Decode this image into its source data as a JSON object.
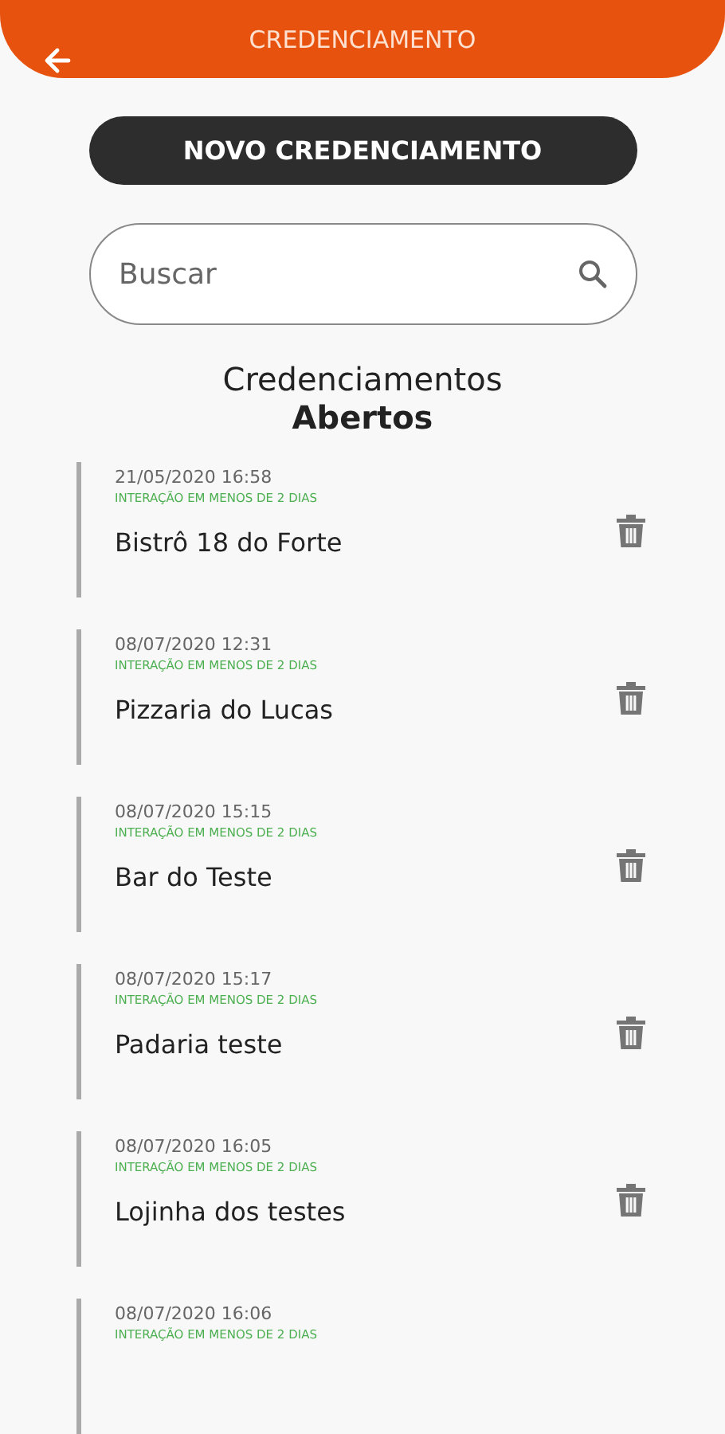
{
  "header": {
    "title": "CREDENCIAMENTO"
  },
  "new_button": {
    "label": "NOVO CREDENCIAMENTO"
  },
  "search": {
    "placeholder": "Buscar"
  },
  "section": {
    "title": "Credenciamentos",
    "subtitle": "Abertos"
  },
  "items": [
    {
      "date": "21/05/2020 16:58",
      "status": "INTERAÇÃO EM MENOS DE 2 DIAS",
      "name": "Bistrô 18 do Forte"
    },
    {
      "date": "08/07/2020 12:31",
      "status": "INTERAÇÃO EM MENOS DE 2 DIAS",
      "name": "Pizzaria do Lucas"
    },
    {
      "date": "08/07/2020 15:15",
      "status": "INTERAÇÃO EM MENOS DE 2 DIAS",
      "name": "Bar do Teste"
    },
    {
      "date": "08/07/2020 15:17",
      "status": "INTERAÇÃO EM MENOS DE 2 DIAS",
      "name": "Padaria teste"
    },
    {
      "date": "08/07/2020 16:05",
      "status": "INTERAÇÃO EM MENOS DE 2 DIAS",
      "name": "Lojinha dos testes"
    },
    {
      "date": "08/07/2020 16:06",
      "status": "INTERAÇÃO EM MENOS DE 2 DIAS"
    }
  ]
}
